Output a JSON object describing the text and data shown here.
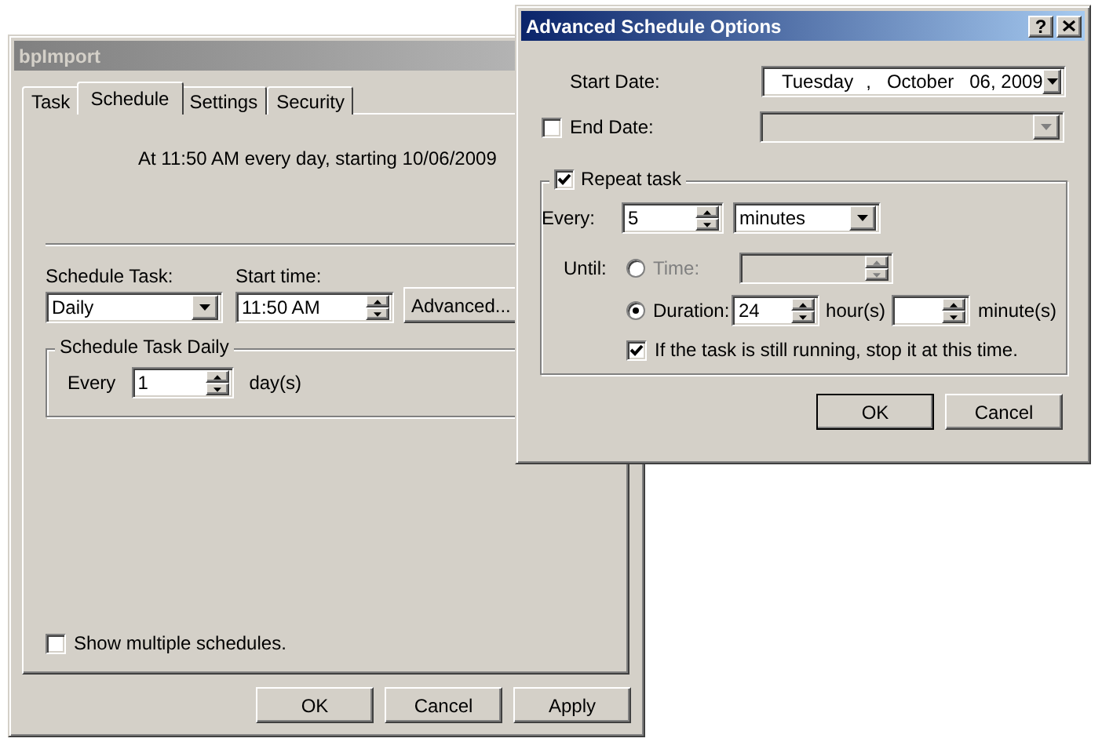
{
  "main_window": {
    "title": "bpImport",
    "active": false,
    "tabs": [
      {
        "label": "Task",
        "selected": false
      },
      {
        "label": "Schedule",
        "selected": true
      },
      {
        "label": "Settings",
        "selected": false
      },
      {
        "label": "Security",
        "selected": false
      }
    ],
    "summary": "At 11:50 AM every day, starting 10/06/2009",
    "schedule_task": {
      "label": "Schedule Task:",
      "value": "Daily"
    },
    "start_time": {
      "label": "Start time:",
      "value": "11:50 AM"
    },
    "advanced_button": "Advanced...",
    "group": {
      "title": "Schedule Task Daily",
      "every_label": "Every",
      "value": "1",
      "unit": "day(s)"
    },
    "show_multiple": {
      "label": "Show multiple schedules.",
      "checked": false
    },
    "buttons": [
      "OK",
      "Cancel",
      "Apply"
    ]
  },
  "dialog": {
    "title": "Advanced Schedule Options",
    "active": true,
    "help_glyph": "?",
    "start_date": {
      "label": "Start Date:",
      "weekday": "Tuesday",
      "separator": ",",
      "month": "October",
      "day_year": "06, 2009"
    },
    "end_date": {
      "label": "End Date:",
      "checked": false
    },
    "repeat": {
      "label": "Repeat task",
      "checked": true,
      "every_label": "Every:",
      "every_value": "5",
      "unit": "minutes",
      "until_label": "Until:",
      "options": [
        {
          "kind": "time",
          "label": "Time:",
          "selected": false
        },
        {
          "kind": "duration",
          "label": "Duration:",
          "selected": true,
          "hours": "24",
          "hours_unit": "hour(s)",
          "minutes_unit": "minute(s)"
        }
      ],
      "stop": {
        "label": "If the task is still running, stop it at this time.",
        "checked": true
      }
    },
    "buttons": [
      "OK",
      "Cancel"
    ]
  }
}
